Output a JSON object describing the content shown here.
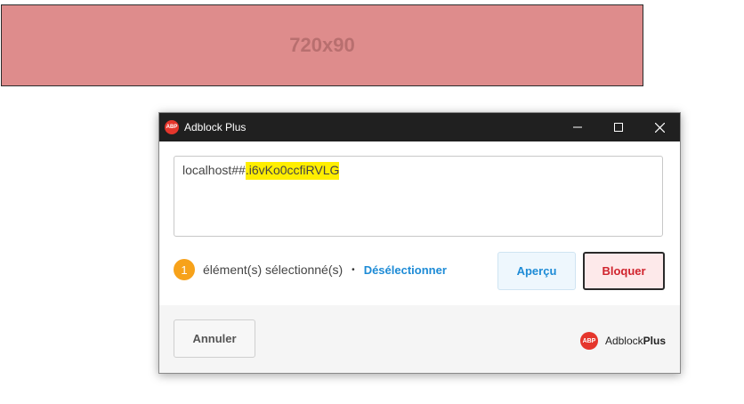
{
  "ad_placeholder": {
    "label": "720x90"
  },
  "window": {
    "logo_text": "ABP",
    "title": "Adblock Plus",
    "controls": {
      "minimize": "—",
      "close": "✕"
    }
  },
  "filter": {
    "prefix": "localhost##",
    "selector": ".i6vKo0ccfiRVLG"
  },
  "selection": {
    "count": "1",
    "label": "élément(s) sélectionné(s)",
    "separator": "•",
    "deselect_label": "Désélectionner"
  },
  "buttons": {
    "preview": "Aperçu",
    "block": "Bloquer",
    "cancel": "Annuler"
  },
  "branding": {
    "logo_text": "ABP",
    "name_regular": "Adblock",
    "name_bold": "Plus"
  },
  "colors": {
    "accent_blue": "#1d8bd6",
    "block_red": "#d0232d",
    "badge_orange": "#f7a21a",
    "highlight_yellow": "#ffee00",
    "logo_red": "#e5362c"
  },
  "icons": {
    "window_logo": "abp-logo-icon",
    "minimize": "minimize-icon",
    "maximize": "maximize-icon",
    "close": "close-icon"
  }
}
